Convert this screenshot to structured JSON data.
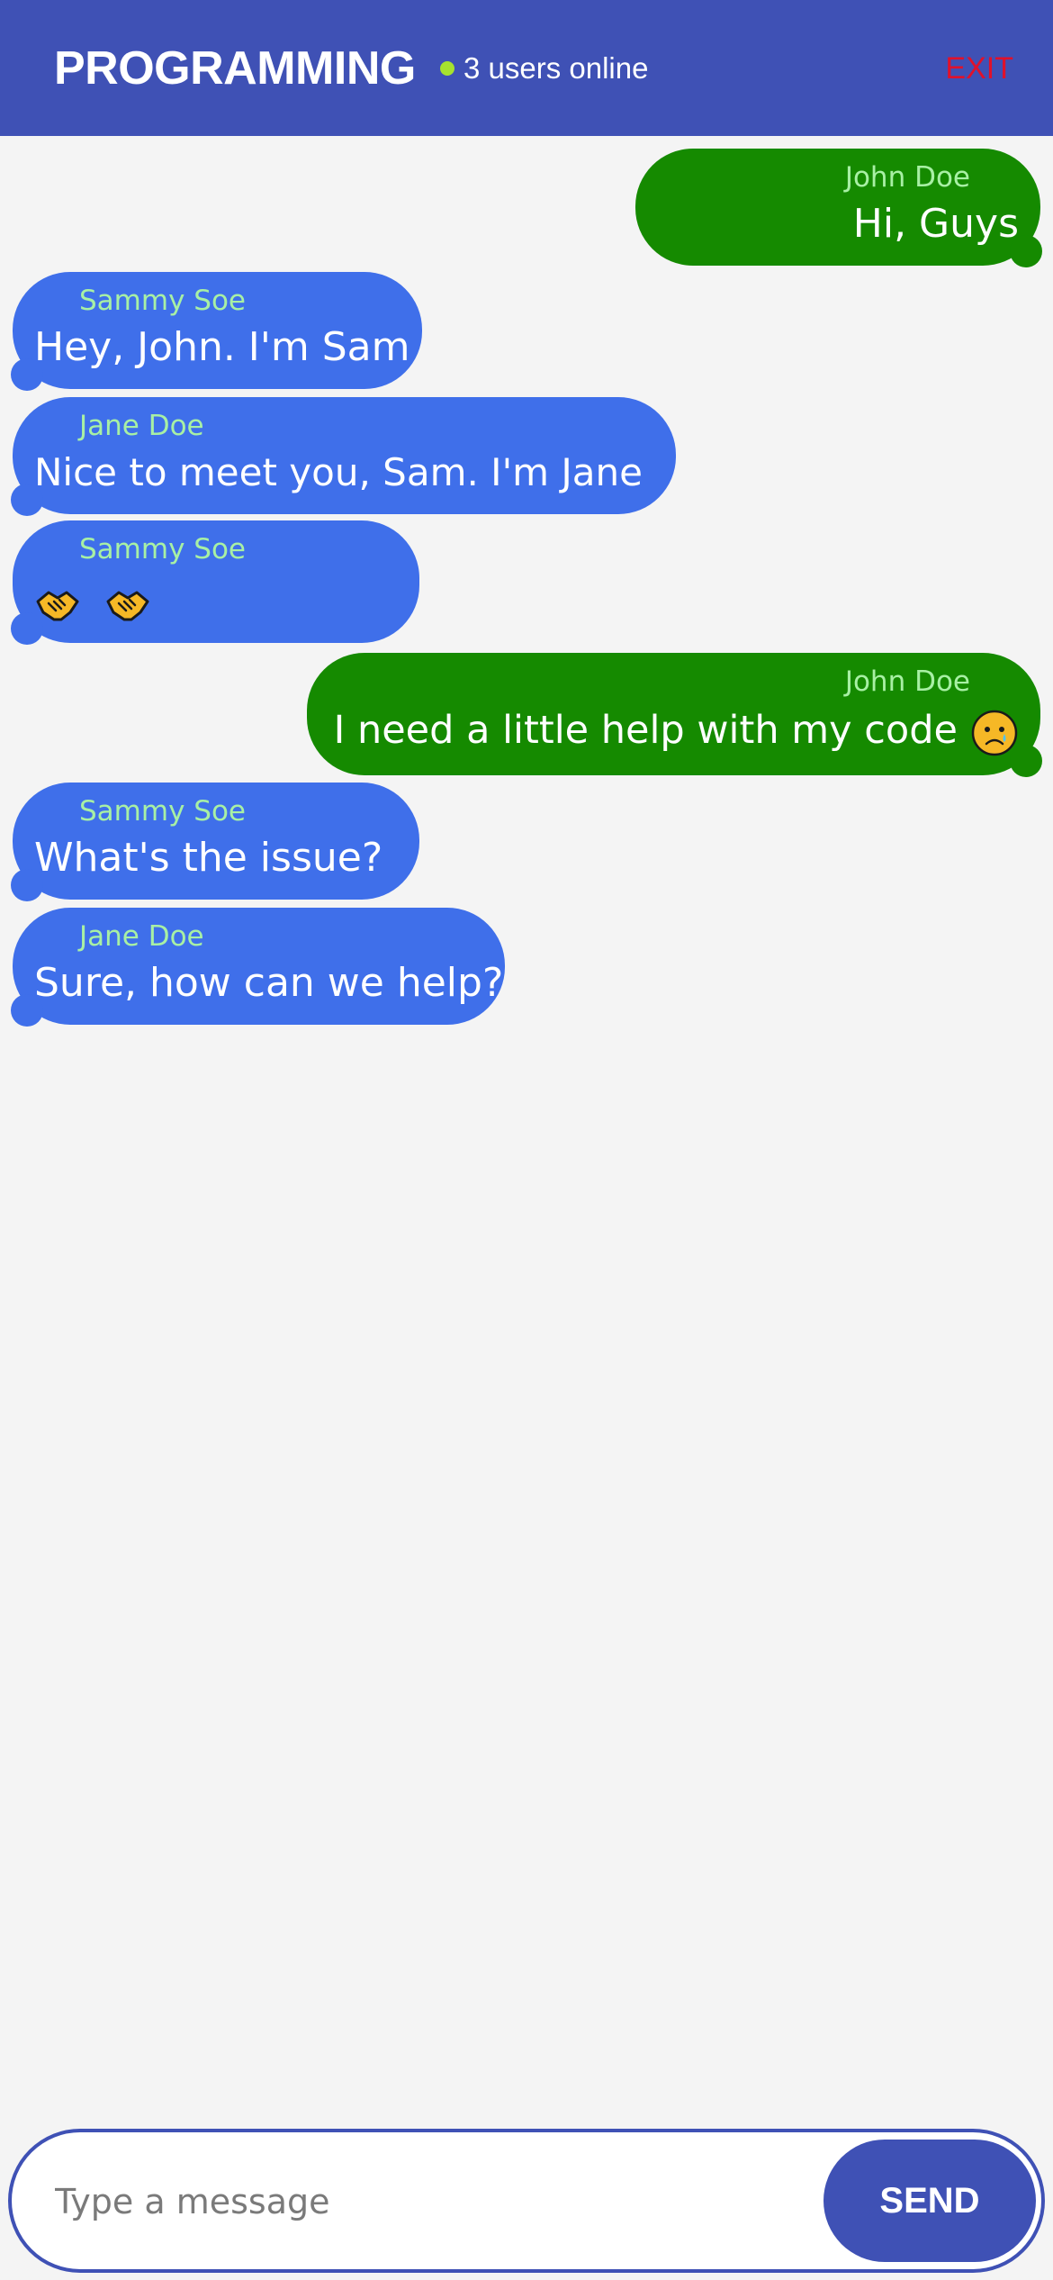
{
  "header": {
    "room_title": "PROGRAMMING",
    "online_text": "3 users online",
    "exit_label": "EXIT"
  },
  "messages": [
    {
      "sender": "John Doe",
      "text": "Hi, Guys",
      "own": true
    },
    {
      "sender": "Sammy Soe",
      "text": "Hey, John. I'm Sam",
      "own": false
    },
    {
      "sender": "Jane Doe",
      "text": "Nice to meet you, Sam. I'm Jane",
      "own": false
    },
    {
      "sender": "Sammy Soe",
      "text": "🤝🤝",
      "own": false,
      "emoji": [
        "handshake-icon",
        "handshake-icon"
      ]
    },
    {
      "sender": "John Doe",
      "text": "I need a little help with my code 😢",
      "own": true,
      "emoji": [
        "crying-face-icon"
      ]
    },
    {
      "sender": "Sammy Soe",
      "text": "What's the issue?",
      "own": false
    },
    {
      "sender": "Jane Doe",
      "text": "Sure, how can we help?",
      "own": false
    }
  ],
  "composer": {
    "placeholder": "Type a message",
    "value": "",
    "send_label": "SEND"
  },
  "colors": {
    "header_bg": "#3f51b5",
    "other_bubble": "#3f6fea",
    "own_bubble": "#158a00",
    "sender_name": "#a8f0a4",
    "exit": "#e0112b",
    "online_dot": "#a6e22e"
  }
}
